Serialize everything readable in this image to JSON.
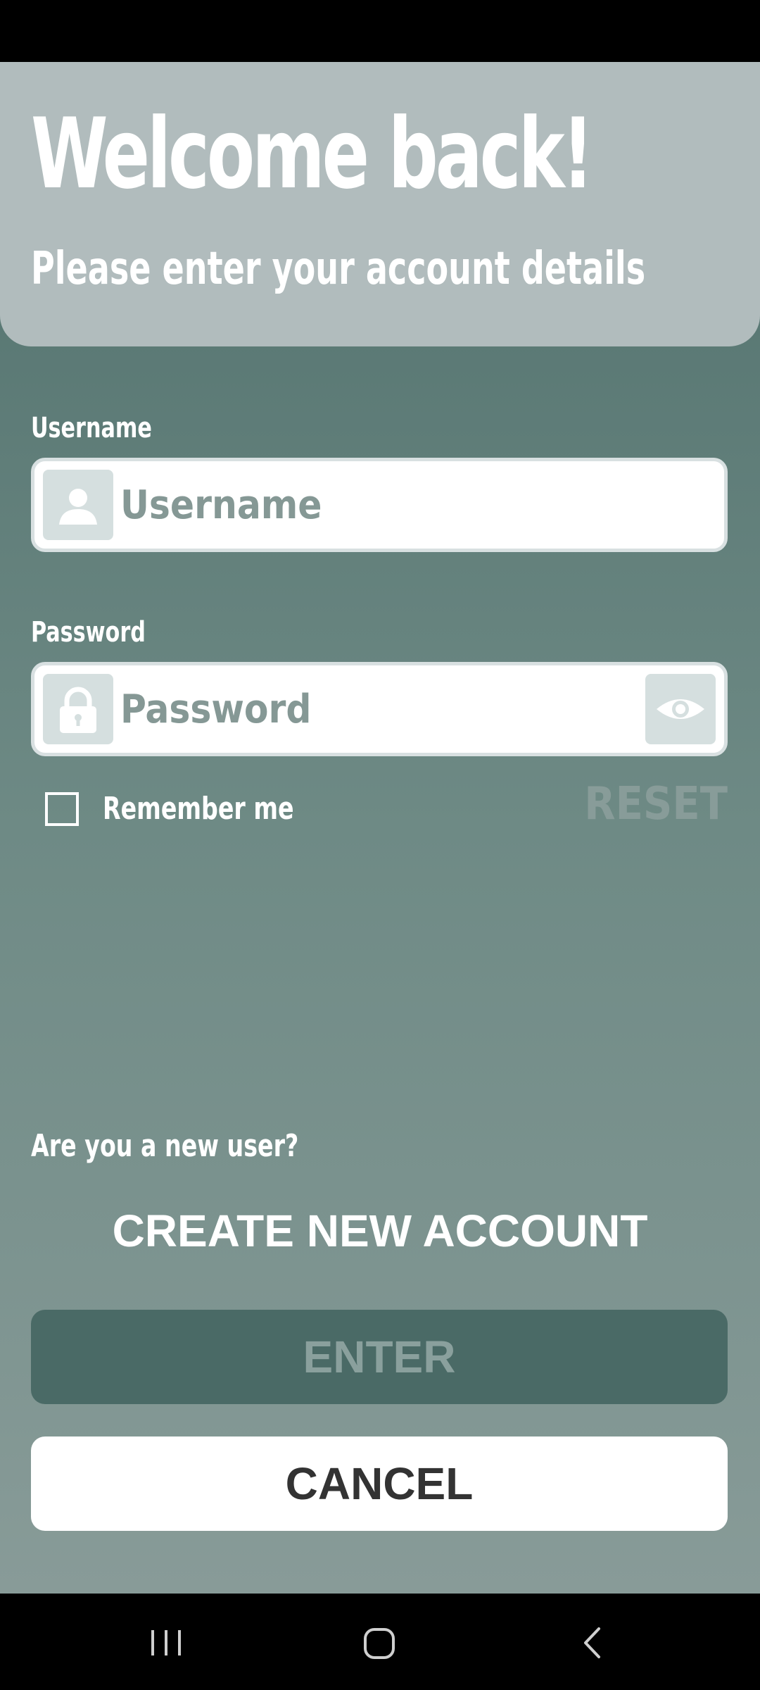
{
  "header": {
    "title": "Welcome back!",
    "subtitle": "Please enter your account details"
  },
  "username": {
    "label": "Username",
    "placeholder": "Username",
    "value": "",
    "icon": "user-icon"
  },
  "password": {
    "label": "Password",
    "placeholder": "Password",
    "value": "",
    "icon": "lock-icon",
    "toggle_icon": "eye-icon"
  },
  "remember": {
    "label": "Remember me",
    "checked": false
  },
  "reset_label": "RESET",
  "new_user_prompt": "Are you a new user?",
  "create_account_label": "CREATE NEW ACCOUNT",
  "enter_label": "ENTER",
  "cancel_label": "CANCEL",
  "nav": {
    "recents_icon": "recents-icon",
    "home_icon": "home-icon",
    "back_icon": "back-icon"
  },
  "colors": {
    "header_bg": "#b1bcbd",
    "enter_bg": "#4a6a66",
    "cancel_bg": "#ffffff",
    "accent_text": "#889c99"
  }
}
